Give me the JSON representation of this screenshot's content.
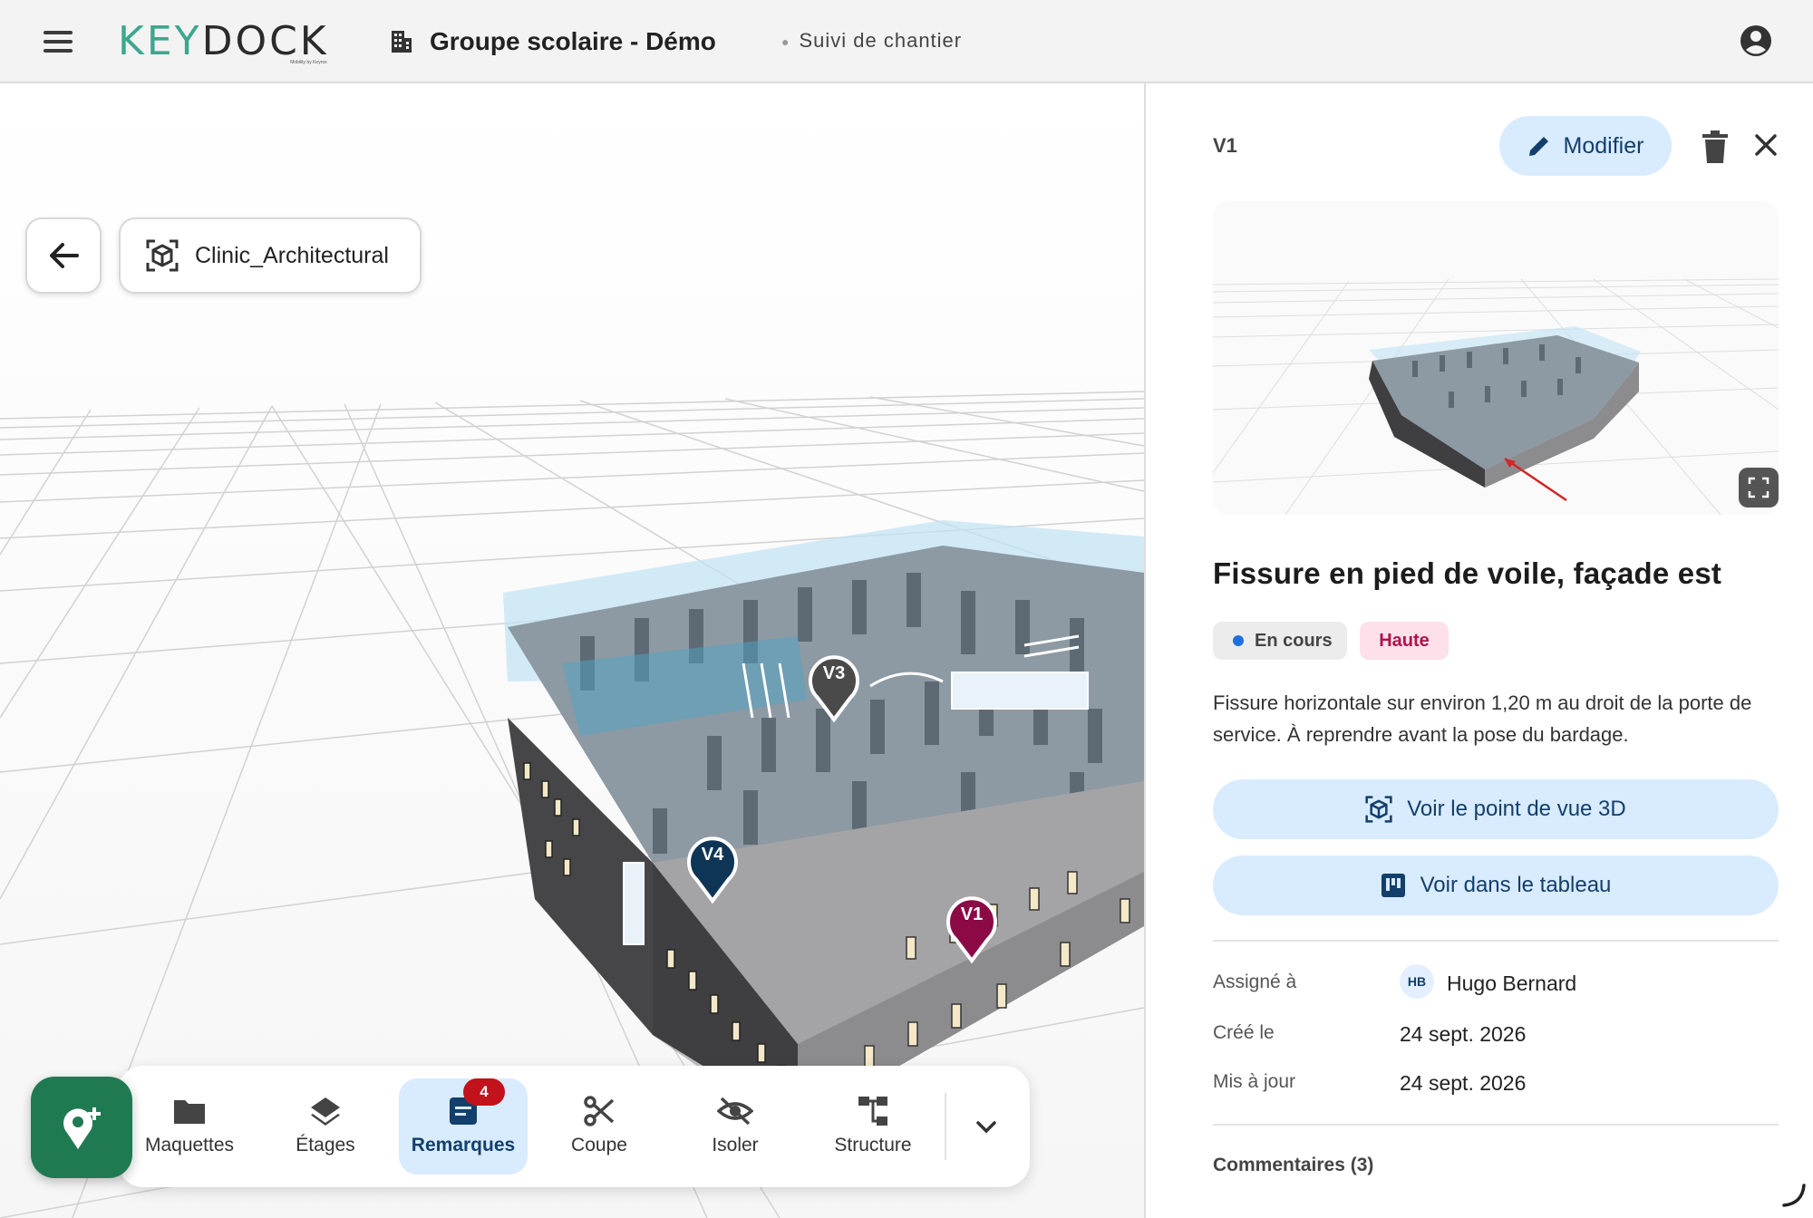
{
  "header": {
    "logo_main": "KEYDOCK",
    "logo_sub": "Mobility by Keyros",
    "project_name": "Groupe scolaire - Démo",
    "subtitle": "Suivi de chantier",
    "icons": [
      "menu-icon",
      "building-icon",
      "account-circle-icon"
    ]
  },
  "viewer": {
    "model_name": "Clinic_Architectural",
    "pins": [
      {
        "id": "V3",
        "color": "#4a4a4a"
      },
      {
        "id": "V4",
        "color": "#0f3556"
      },
      {
        "id": "V1",
        "color": "#8b0a45"
      }
    ],
    "toolbar": {
      "items": [
        {
          "label": "Maquettes",
          "icon": "folder-icon"
        },
        {
          "label": "Étages",
          "icon": "layers-icon"
        },
        {
          "label": "Remarques",
          "icon": "remarks-icon",
          "badge": "4",
          "active": true
        },
        {
          "label": "Coupe",
          "icon": "scissors-icon"
        },
        {
          "label": "Isoler",
          "icon": "eye-off-icon"
        },
        {
          "label": "Structure",
          "icon": "structure-icon"
        }
      ],
      "more_icon": "chevron-down-icon",
      "add_icon": "add-location-icon"
    }
  },
  "panel": {
    "id": "V1",
    "edit_label": "Modifier",
    "title": "Fissure en pied de voile, façade est",
    "status": "En cours",
    "priority": "Haute",
    "description": "Fissure horizontale sur environ 1,20 m au droit de la porte de service. À reprendre avant la pose du bardage.",
    "view3d_label": "Voir le point de vue 3D",
    "table_label": "Voir dans le tableau",
    "assigned_label": "Assigné à",
    "assignee_initials": "HB",
    "assignee_name": "Hugo Bernard",
    "created_label": "Créé le",
    "created_value": "24 sept. 2026",
    "updated_label": "Mis à jour",
    "updated_value": "24 sept. 2026",
    "comments_label": "Commentaires (3)"
  },
  "colors": {
    "accent": "#1f7a52",
    "button_bg": "#d9ebff",
    "button_text": "#123f6b",
    "badge": "#c2121c",
    "status_dot": "#1e6fe0",
    "priority_text": "#b0124b"
  }
}
